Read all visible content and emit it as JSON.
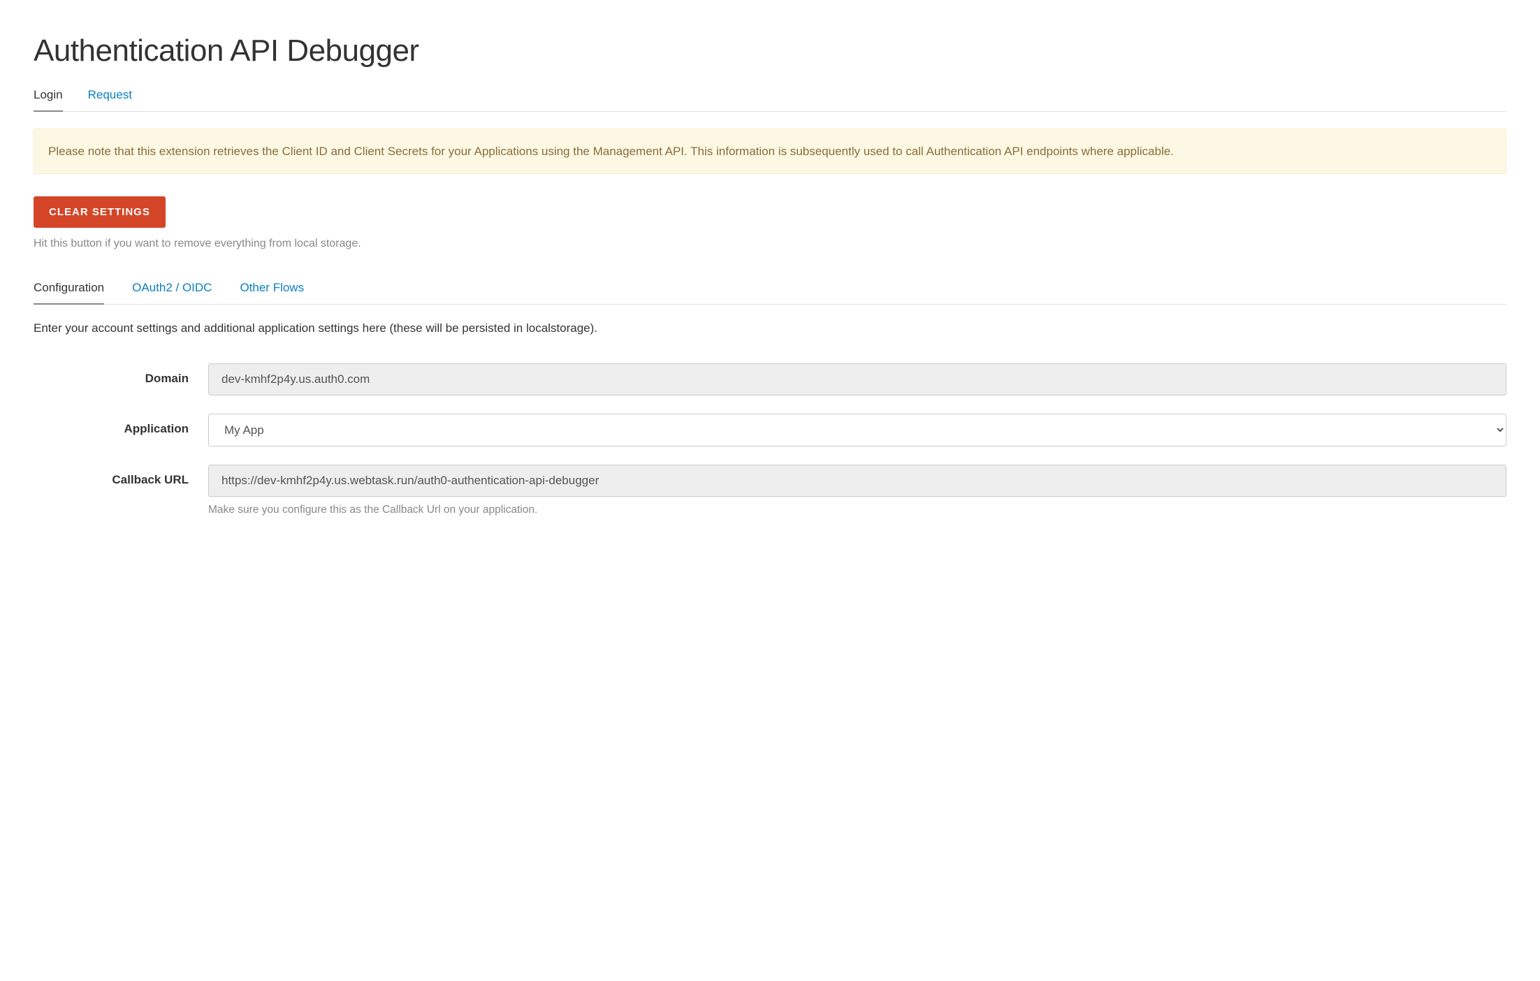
{
  "page_title": "Authentication API Debugger",
  "top_tabs": [
    {
      "label": "Login",
      "active": true
    },
    {
      "label": "Request",
      "active": false
    }
  ],
  "alert": "Please note that this extension retrieves the Client ID and Client Secrets for your Applications using the Management API. This information is subsequently used to call Authentication API endpoints where applicable.",
  "clear_button_label": "CLEAR SETTINGS",
  "clear_help": "Hit this button if you want to remove everything from local storage.",
  "sub_tabs": [
    {
      "label": "Configuration",
      "active": true
    },
    {
      "label": "OAuth2 / OIDC",
      "active": false
    },
    {
      "label": "Other Flows",
      "active": false
    }
  ],
  "section_desc": "Enter your account settings and additional application settings here (these will be persisted in localstorage).",
  "form": {
    "domain": {
      "label": "Domain",
      "value": "dev-kmhf2p4y.us.auth0.com"
    },
    "application": {
      "label": "Application",
      "value": "My App",
      "options": [
        "My App"
      ]
    },
    "callback_url": {
      "label": "Callback URL",
      "value": "https://dev-kmhf2p4y.us.webtask.run/auth0-authentication-api-debugger",
      "help": "Make sure you configure this as the Callback Url on your application."
    }
  }
}
